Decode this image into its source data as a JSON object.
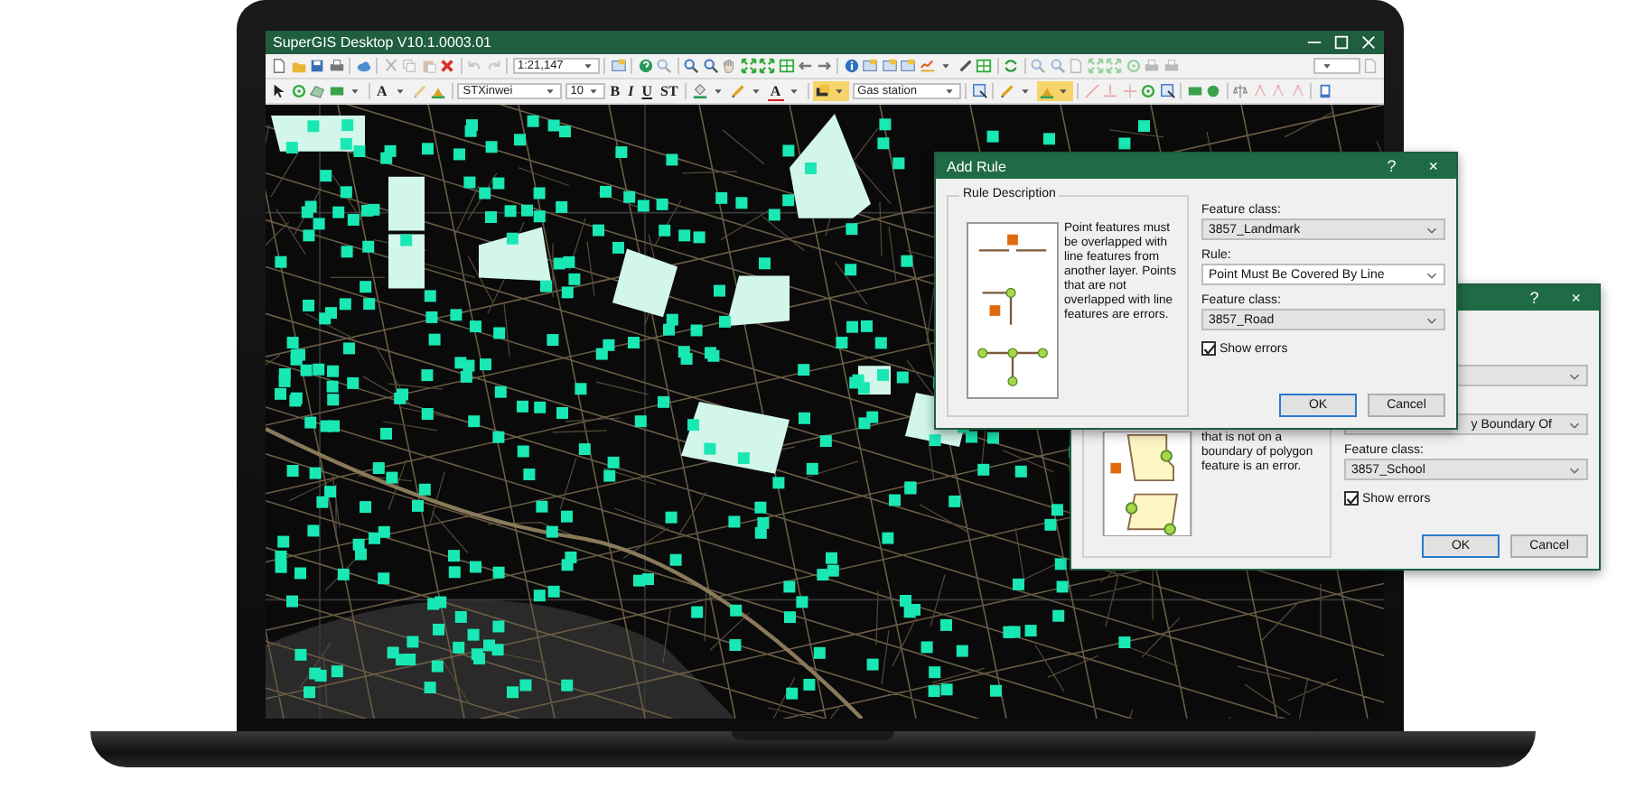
{
  "window": {
    "title": "SuperGIS Desktop V10.1.0003.01"
  },
  "toolbar_1": {
    "scale": "1:21,147"
  },
  "toolbar_2": {
    "text_tool": "A",
    "font": "STXinwei",
    "font_size": "10",
    "format_buttons": [
      "B",
      "I",
      "U",
      "ST"
    ],
    "font_color": "A",
    "layer": "Gas station"
  },
  "add_rule_dialog": {
    "title": "Add Rule",
    "help": "?",
    "close": "×",
    "group_label": "Rule Description",
    "description": "Point features must be overlapped with line features from another layer. Points that are not overlapped with line features are errors.",
    "fields": [
      {
        "label": "Feature class:",
        "value": "3857_Landmark"
      },
      {
        "label": "Rule:",
        "value": "Point Must Be Covered By Line"
      },
      {
        "label": "Feature class:",
        "value": "3857_Road"
      }
    ],
    "show_errors": {
      "label": "Show errors",
      "checked": true
    },
    "buttons": [
      "OK",
      "Cancel"
    ]
  },
  "back_dialog": {
    "help": "?",
    "close": "×",
    "description": "that is not on a boundary of polygon feature is an error.",
    "rule_value": "y Boundary Of",
    "fields": [
      {
        "label": "Feature class:",
        "value": "3857_School"
      }
    ],
    "show_errors": {
      "label": "Show errors",
      "checked": true
    },
    "buttons": [
      "OK",
      "Cancel"
    ]
  }
}
